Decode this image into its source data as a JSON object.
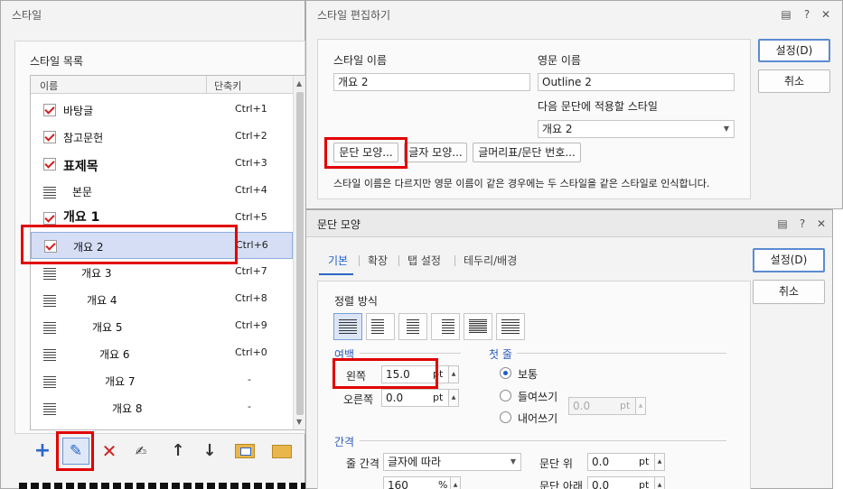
{
  "style_dialog": {
    "title": "스타일",
    "list_label": "스타일 목록",
    "col_name": "이름",
    "col_key": "단축키",
    "items": [
      {
        "name": "바탕글",
        "key": "Ctrl+1",
        "icon": "checkmark-icon"
      },
      {
        "name": "참고문헌",
        "key": "Ctrl+2",
        "icon": "checkmark-icon"
      },
      {
        "name": "표제목",
        "key": "Ctrl+3",
        "icon": "checkmark-icon"
      },
      {
        "name": "본문",
        "key": "Ctrl+4",
        "icon": "paragraph-lines-icon"
      },
      {
        "name": "개요 1",
        "key": "Ctrl+5",
        "icon": "checkmark-icon"
      },
      {
        "name": "개요 2",
        "key": "Ctrl+6",
        "icon": "checkmark-icon"
      },
      {
        "name": "개요 3",
        "key": "Ctrl+7",
        "icon": "paragraph-lines-icon"
      },
      {
        "name": "개요 4",
        "key": "Ctrl+8",
        "icon": "paragraph-lines-icon"
      },
      {
        "name": "개요 5",
        "key": "Ctrl+9",
        "icon": "paragraph-lines-icon"
      },
      {
        "name": "개요 6",
        "key": "Ctrl+0",
        "icon": "paragraph-lines-icon"
      },
      {
        "name": "개요 7",
        "key": "-",
        "icon": "paragraph-lines-icon"
      },
      {
        "name": "개요 8",
        "key": "-",
        "icon": "paragraph-lines-icon"
      }
    ],
    "selected_index": 5,
    "toolbar_icons": [
      "plus-icon",
      "pencil-icon",
      "delete-x-icon",
      "edit-style-icon",
      "arrow-up-icon",
      "arrow-down-icon",
      "import-icon",
      "open-folder-icon"
    ]
  },
  "edit_dialog": {
    "title": "스타일 편집하기",
    "style_name_label": "스타일 이름",
    "style_name_value": "개요 2",
    "english_name_label": "영문 이름",
    "english_name_value": "Outline 2",
    "next_style_label": "다음 문단에 적용할 스타일",
    "next_style_value": "개요 2",
    "btn_paragraph": "문단 모양...",
    "btn_char": "글자 모양...",
    "btn_bullet": "글머리표/문단 번호...",
    "note": "스타일 이름은 다르지만 영문 이름이 같은 경우에는 두 스타일을 같은 스타일로 인식합니다.",
    "ok": "설정(D)",
    "cancel": "취소"
  },
  "para_dialog": {
    "title": "문단 모양",
    "tabs": [
      "기본",
      "확장",
      "탭 설정",
      "테두리/배경"
    ],
    "active_tab": 0,
    "ok": "설정(D)",
    "cancel": "취소",
    "align_label": "정렬 방식",
    "align_icons": [
      "align-justify-icon",
      "align-left-icon",
      "align-center-icon",
      "align-right-icon",
      "align-distribute-icon",
      "align-divide-icon"
    ],
    "margin_label": "여백",
    "left_label": "왼쪽",
    "left_value": "15.0",
    "right_label": "오른쪽",
    "right_value": "0.0",
    "unit": "pt",
    "first_line_label": "첫 줄",
    "first_opts": [
      "보통",
      "들여쓰기",
      "내어쓰기"
    ],
    "first_selected": 0,
    "first_value": "0.0",
    "spacing_label": "간격",
    "line_spacing_label": "줄 간격",
    "line_spacing_type": "글자에 따라",
    "line_spacing_value": "160",
    "percent_unit": "%",
    "para_above_label": "문단 위",
    "para_above_value": "0.0",
    "para_below_label": "문단 아래",
    "para_below_value": "0.0"
  },
  "colors": {
    "highlight": "#e10000",
    "selection": "#d5def5",
    "accent": "#1d5fc8"
  }
}
